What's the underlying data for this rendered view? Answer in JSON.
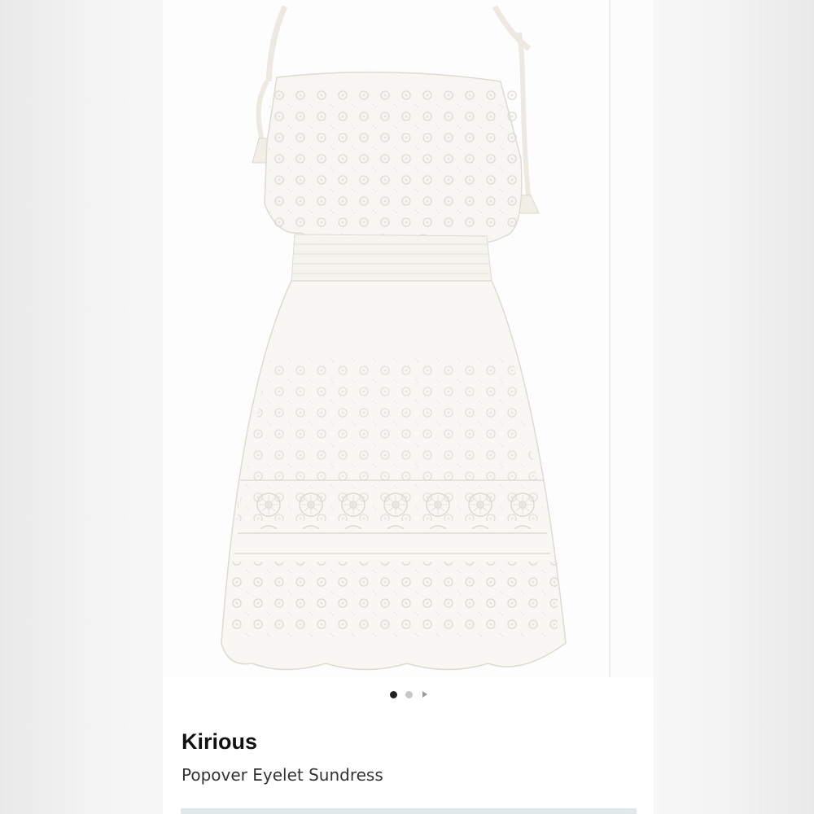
{
  "product_card": {
    "brand": "Kirious",
    "product_name": "Popover Eyelet Sundress",
    "gallery": {
      "image_alt": "White eyelet sundress with tie straps",
      "page_count": 3,
      "active_page": 1
    }
  },
  "colors": {
    "dress": "#f7f6f2",
    "background": "#ffffff",
    "dot_active": "#222222",
    "dot_inactive": "#c8c8c8"
  }
}
